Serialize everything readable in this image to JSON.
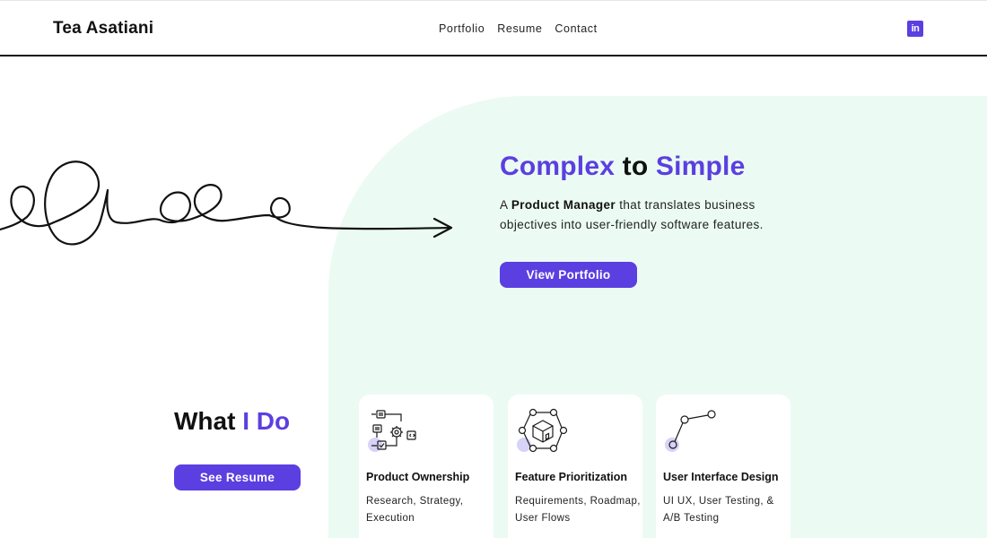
{
  "header": {
    "brand": "Tea Asatiani",
    "nav": [
      "Portfolio",
      "Resume",
      "Contact"
    ],
    "social": {
      "icon": "linkedin-icon",
      "glyph": "in"
    }
  },
  "hero": {
    "title_part1": "Complex",
    "title_part2": " to ",
    "title_part3": "Simple",
    "desc_prefix": "A ",
    "desc_bold": "Product Manager",
    "desc_suffix": " that translates business objectives into user-friendly software features.",
    "button": "View Portfolio"
  },
  "what": {
    "title_part1": "What ",
    "title_part2": "I Do",
    "button": "See Resume"
  },
  "cards": [
    {
      "icon": "workflow-icon",
      "title": "Product Ownership",
      "desc": "Research, Strategy, Execution"
    },
    {
      "icon": "package-network-icon",
      "title": "Feature Prioritization",
      "desc": "Requirements, Roadmap, User Flows"
    },
    {
      "icon": "node-graph-icon",
      "title": "User Interface Design",
      "desc": "UI UX, User Testing, & A/B Testing"
    }
  ],
  "colors": {
    "accent": "#5b3fe0",
    "hero_background": "#ebfbf3",
    "text": "#111111"
  }
}
